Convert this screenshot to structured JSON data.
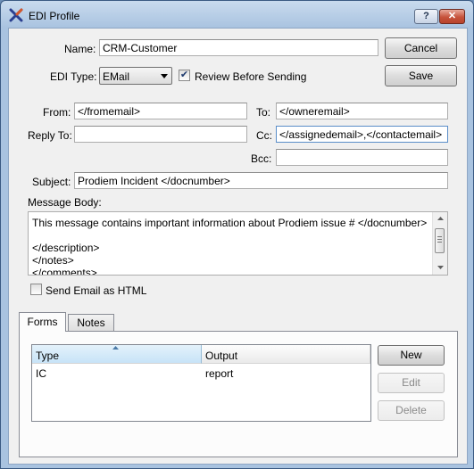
{
  "window": {
    "title": "EDI Profile",
    "help_label": "?",
    "close_label": "✕"
  },
  "form": {
    "name_label": "Name:",
    "name_value": "CRM-Customer",
    "edi_type_label": "EDI Type:",
    "edi_type_value": "EMail",
    "review_label": "Review Before Sending",
    "review_checked": true,
    "from_label": "From:",
    "from_value": "</fromemail>",
    "to_label": "To:",
    "to_value": "</owneremail>",
    "reply_to_label": "Reply To:",
    "reply_to_value": "",
    "cc_label": "Cc:",
    "cc_value": "</assignedemail>,</contactemail>",
    "bcc_label": "Bcc:",
    "bcc_value": "",
    "subject_label": "Subject:",
    "subject_value": "Prodiem Incident </docnumber>",
    "message_body_label": "Message Body:",
    "message_lines": [
      "This message contains important information about Prodiem issue # </docnumber>",
      "",
      "</description>",
      "</notes>",
      "</comments>"
    ],
    "html_label": "Send Email as HTML",
    "html_checked": false
  },
  "buttons": {
    "cancel": "Cancel",
    "save": "Save",
    "new": "New",
    "edit": "Edit",
    "delete": "Delete"
  },
  "tabs": [
    {
      "label": "Forms",
      "active": true
    },
    {
      "label": "Notes",
      "active": false
    }
  ],
  "forms_table": {
    "columns": [
      "Type",
      "Output"
    ],
    "rows": [
      {
        "type": "IC",
        "output": "report"
      }
    ]
  },
  "colors": {
    "title_gradient_top": "#c9dbee",
    "title_gradient_bottom": "#a9c3e0",
    "close_button": "#c6523b",
    "dialog_bg": "#f0f0f0"
  }
}
